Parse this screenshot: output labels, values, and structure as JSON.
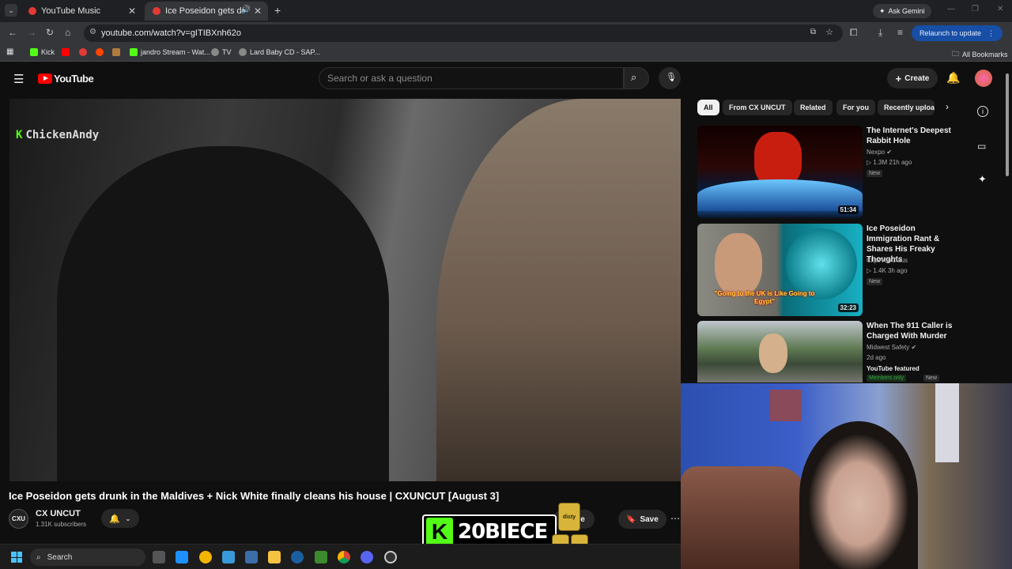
{
  "browser": {
    "tabs": [
      {
        "label": "YouTube Music"
      },
      {
        "label": "Ice Poseidon gets drunk in"
      }
    ],
    "url": "youtube.com/watch?v=gITIBXnh62o",
    "ask_gemini": "Ask Gemini",
    "relaunch": "Relaunch to update",
    "bookmarks": [
      "Kick",
      "jandro Stream - Wat...",
      "TV",
      "Lard Baby CD - SAP..."
    ],
    "all_bookmarks": "All Bookmarks"
  },
  "youtube": {
    "logo": "YouTube",
    "search_placeholder": "Search or ask a question",
    "create": "Create",
    "overlay_label": "ChickenAndy",
    "video_title": "Ice Poseidon gets drunk in the Maldives + Nick White finally cleans his house | CXUNCUT [August 3]",
    "channel": {
      "avatar": "CXU",
      "name": "CX UNCUT",
      "subs": "1.31K subscribers"
    },
    "actions": {
      "share": "Share",
      "save": "Save"
    },
    "chips": [
      "All",
      "From CX UNCUT",
      "Related",
      "For you",
      "Recently uploaded"
    ],
    "recommendations": [
      {
        "title": "The Internet's Deepest Rabbit Hole",
        "channel": "Nexpo",
        "stats": "1.3M  21h ago",
        "badge": "New",
        "duration": "51:34"
      },
      {
        "title": "Ice Poseidon Immigration Rant & Shares His Freaky Thoughts",
        "channel": "ClipsVonClaus",
        "stats": "1.4K  3h ago",
        "badge": "New",
        "duration": "32:23",
        "caption": "\"Going to the UK is Like Going to Egypt\""
      },
      {
        "title": "When The 911 Caller is Charged With Murder",
        "channel": "Midwest Safety",
        "stats": "2d ago",
        "featured": "YouTube featured",
        "members": "Members only",
        "badge": "New"
      }
    ]
  },
  "stream_overlay": {
    "text": "20BIECE",
    "kick": "K",
    "can_label": "disty"
  },
  "taskbar": {
    "search": "Search"
  }
}
